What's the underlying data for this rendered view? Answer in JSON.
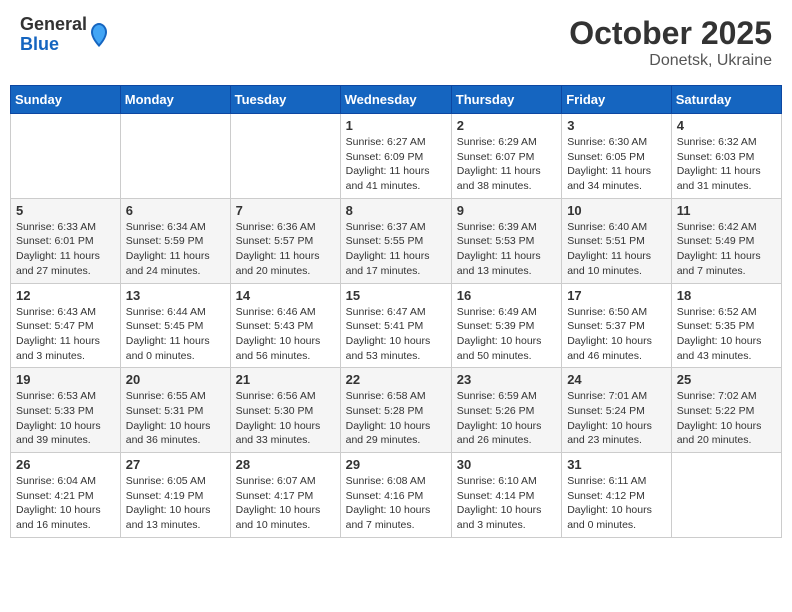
{
  "header": {
    "logo_general": "General",
    "logo_blue": "Blue",
    "month_title": "October 2025",
    "location": "Donetsk, Ukraine"
  },
  "weekdays": [
    "Sunday",
    "Monday",
    "Tuesday",
    "Wednesday",
    "Thursday",
    "Friday",
    "Saturday"
  ],
  "weeks": [
    [
      {
        "day": "",
        "info": ""
      },
      {
        "day": "",
        "info": ""
      },
      {
        "day": "",
        "info": ""
      },
      {
        "day": "1",
        "info": "Sunrise: 6:27 AM\nSunset: 6:09 PM\nDaylight: 11 hours\nand 41 minutes."
      },
      {
        "day": "2",
        "info": "Sunrise: 6:29 AM\nSunset: 6:07 PM\nDaylight: 11 hours\nand 38 minutes."
      },
      {
        "day": "3",
        "info": "Sunrise: 6:30 AM\nSunset: 6:05 PM\nDaylight: 11 hours\nand 34 minutes."
      },
      {
        "day": "4",
        "info": "Sunrise: 6:32 AM\nSunset: 6:03 PM\nDaylight: 11 hours\nand 31 minutes."
      }
    ],
    [
      {
        "day": "5",
        "info": "Sunrise: 6:33 AM\nSunset: 6:01 PM\nDaylight: 11 hours\nand 27 minutes."
      },
      {
        "day": "6",
        "info": "Sunrise: 6:34 AM\nSunset: 5:59 PM\nDaylight: 11 hours\nand 24 minutes."
      },
      {
        "day": "7",
        "info": "Sunrise: 6:36 AM\nSunset: 5:57 PM\nDaylight: 11 hours\nand 20 minutes."
      },
      {
        "day": "8",
        "info": "Sunrise: 6:37 AM\nSunset: 5:55 PM\nDaylight: 11 hours\nand 17 minutes."
      },
      {
        "day": "9",
        "info": "Sunrise: 6:39 AM\nSunset: 5:53 PM\nDaylight: 11 hours\nand 13 minutes."
      },
      {
        "day": "10",
        "info": "Sunrise: 6:40 AM\nSunset: 5:51 PM\nDaylight: 11 hours\nand 10 minutes."
      },
      {
        "day": "11",
        "info": "Sunrise: 6:42 AM\nSunset: 5:49 PM\nDaylight: 11 hours\nand 7 minutes."
      }
    ],
    [
      {
        "day": "12",
        "info": "Sunrise: 6:43 AM\nSunset: 5:47 PM\nDaylight: 11 hours\nand 3 minutes."
      },
      {
        "day": "13",
        "info": "Sunrise: 6:44 AM\nSunset: 5:45 PM\nDaylight: 11 hours\nand 0 minutes."
      },
      {
        "day": "14",
        "info": "Sunrise: 6:46 AM\nSunset: 5:43 PM\nDaylight: 10 hours\nand 56 minutes."
      },
      {
        "day": "15",
        "info": "Sunrise: 6:47 AM\nSunset: 5:41 PM\nDaylight: 10 hours\nand 53 minutes."
      },
      {
        "day": "16",
        "info": "Sunrise: 6:49 AM\nSunset: 5:39 PM\nDaylight: 10 hours\nand 50 minutes."
      },
      {
        "day": "17",
        "info": "Sunrise: 6:50 AM\nSunset: 5:37 PM\nDaylight: 10 hours\nand 46 minutes."
      },
      {
        "day": "18",
        "info": "Sunrise: 6:52 AM\nSunset: 5:35 PM\nDaylight: 10 hours\nand 43 minutes."
      }
    ],
    [
      {
        "day": "19",
        "info": "Sunrise: 6:53 AM\nSunset: 5:33 PM\nDaylight: 10 hours\nand 39 minutes."
      },
      {
        "day": "20",
        "info": "Sunrise: 6:55 AM\nSunset: 5:31 PM\nDaylight: 10 hours\nand 36 minutes."
      },
      {
        "day": "21",
        "info": "Sunrise: 6:56 AM\nSunset: 5:30 PM\nDaylight: 10 hours\nand 33 minutes."
      },
      {
        "day": "22",
        "info": "Sunrise: 6:58 AM\nSunset: 5:28 PM\nDaylight: 10 hours\nand 29 minutes."
      },
      {
        "day": "23",
        "info": "Sunrise: 6:59 AM\nSunset: 5:26 PM\nDaylight: 10 hours\nand 26 minutes."
      },
      {
        "day": "24",
        "info": "Sunrise: 7:01 AM\nSunset: 5:24 PM\nDaylight: 10 hours\nand 23 minutes."
      },
      {
        "day": "25",
        "info": "Sunrise: 7:02 AM\nSunset: 5:22 PM\nDaylight: 10 hours\nand 20 minutes."
      }
    ],
    [
      {
        "day": "26",
        "info": "Sunrise: 6:04 AM\nSunset: 4:21 PM\nDaylight: 10 hours\nand 16 minutes."
      },
      {
        "day": "27",
        "info": "Sunrise: 6:05 AM\nSunset: 4:19 PM\nDaylight: 10 hours\nand 13 minutes."
      },
      {
        "day": "28",
        "info": "Sunrise: 6:07 AM\nSunset: 4:17 PM\nDaylight: 10 hours\nand 10 minutes."
      },
      {
        "day": "29",
        "info": "Sunrise: 6:08 AM\nSunset: 4:16 PM\nDaylight: 10 hours\nand 7 minutes."
      },
      {
        "day": "30",
        "info": "Sunrise: 6:10 AM\nSunset: 4:14 PM\nDaylight: 10 hours\nand 3 minutes."
      },
      {
        "day": "31",
        "info": "Sunrise: 6:11 AM\nSunset: 4:12 PM\nDaylight: 10 hours\nand 0 minutes."
      },
      {
        "day": "",
        "info": ""
      }
    ]
  ]
}
